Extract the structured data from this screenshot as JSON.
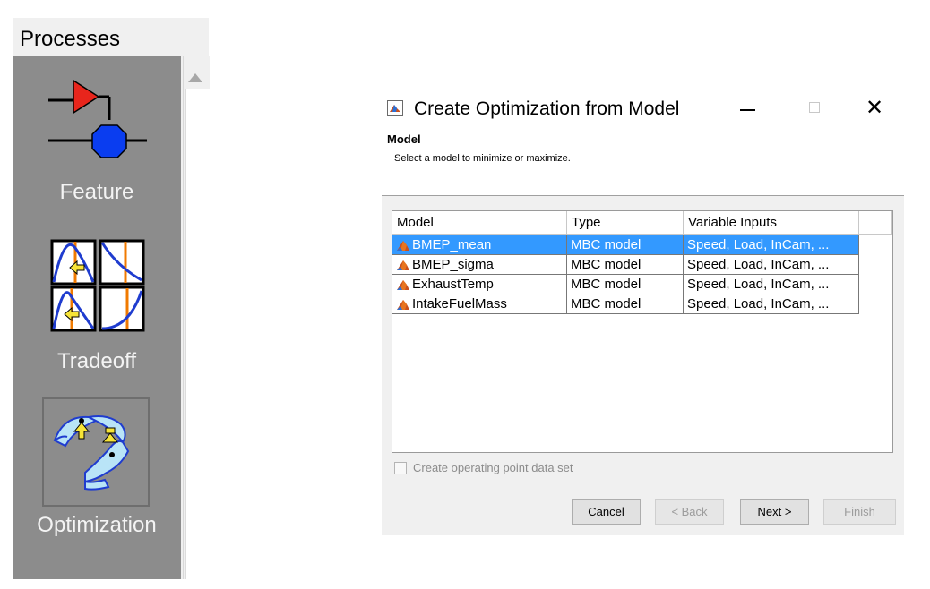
{
  "processes": {
    "title": "Processes",
    "items": [
      {
        "label": "Feature",
        "icon": "feature-icon"
      },
      {
        "label": "Tradeoff",
        "icon": "tradeoff-icon"
      },
      {
        "label": "Optimization",
        "icon": "optimization-icon"
      }
    ]
  },
  "dialog": {
    "title": "Create Optimization from Model",
    "step_title": "Model",
    "step_description": "Select a model to minimize or maximize.",
    "table": {
      "columns": [
        "Model",
        "Type",
        "Variable Inputs"
      ],
      "rows": [
        {
          "model": "BMEP_mean",
          "type": "MBC model",
          "inputs": "Speed, Load, InCam, ...",
          "selected": true
        },
        {
          "model": "BMEP_sigma",
          "type": "MBC model",
          "inputs": "Speed, Load, InCam, ...",
          "selected": false
        },
        {
          "model": "ExhaustTemp",
          "type": "MBC model",
          "inputs": "Speed, Load, InCam, ...",
          "selected": false
        },
        {
          "model": "IntakeFuelMass",
          "type": "MBC model",
          "inputs": "Speed, Load, InCam, ...",
          "selected": false
        }
      ]
    },
    "checkbox_label": "Create operating point data set",
    "checkbox_checked": false,
    "buttons": {
      "cancel": "Cancel",
      "back": "< Back",
      "next": "Next >",
      "finish": "Finish"
    }
  },
  "colors": {
    "selection": "#3399ff",
    "panel_bg": "#8c8c8c",
    "dialog_bg": "#f0f0f0"
  }
}
